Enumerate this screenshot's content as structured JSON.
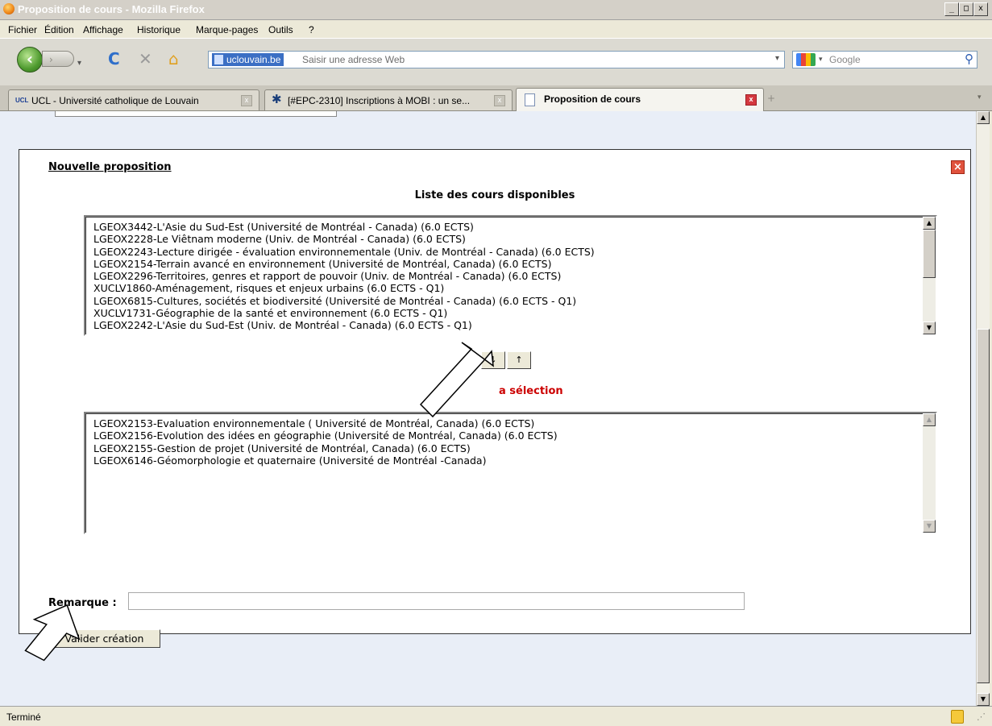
{
  "window": {
    "title": "Proposition de cours - Mozilla Firefox",
    "controls": {
      "minimize": "_",
      "maximize": "□",
      "close": "x"
    }
  },
  "menu": [
    "Fichier",
    "Édition",
    "Affichage",
    "Historique",
    "Marque-pages",
    "Outils",
    "?"
  ],
  "nav": {
    "site_badge": "uclouvain.be",
    "url_placeholder": "Saisir une adresse Web",
    "search_placeholder": "Google"
  },
  "tabs": [
    {
      "label": "UCL - Université catholique de Louvain",
      "favicon": "ucl"
    },
    {
      "label": "[#EPC-2310] Inscriptions à MOBI : un se...",
      "favicon": "jira"
    },
    {
      "label": "Proposition de cours",
      "active": true
    }
  ],
  "panel": {
    "title": "Nouvelle proposition",
    "available_heading": "Liste des cours disponibles",
    "available": [
      "LGEOX3442-L'Asie du Sud-Est (Université de Montréal - Canada) (6.0 ECTS)",
      "LGEOX2228-Le Viêtnam moderne (Univ. de Montréal - Canada) (6.0 ECTS)",
      "LGEOX2243-Lecture dirigée - évaluation environnementale (Univ. de Montréal - Canada) (6.0 ECTS)",
      "LGEOX2154-Terrain avancé en environnement (Université de Montréal, Canada) (6.0 ECTS)",
      "LGEOX2296-Territoires, genres et rapport de pouvoir (Univ. de Montréal - Canada) (6.0 ECTS)",
      "XUCLV1860-Aménagement, risques et enjeux urbains (6.0 ECTS - Q1)",
      "LGEOX6815-Cultures, sociétés et biodiversité (Université de Montréal - Canada) (6.0 ECTS - Q1)",
      "XUCLV1731-Géographie de la santé et environnement (6.0 ECTS - Q1)",
      "LGEOX2242-L'Asie du Sud-Est (Univ. de Montréal - Canada) (6.0 ECTS - Q1)"
    ],
    "move_down_label": "↓",
    "move_up_label": "↑",
    "selection_heading": "a sélection",
    "selection": [
      "LGEOX2153-Evaluation environnementale ( Université de Montréal, Canada) (6.0 ECTS)",
      "LGEOX2156-Evolution des idées en géographie (Université de Montréal, Canada) (6.0 ECTS)",
      "LGEOX2155-Gestion de projet (Université de Montréal, Canada) (6.0 ECTS)",
      "LGEOX6146-Géomorphologie et quaternaire (Université de Montréal -Canada)"
    ],
    "remark_label": "Remarque :",
    "remark_value": "",
    "submit_label": "Valider création"
  },
  "status": {
    "text": "Terminé"
  },
  "colors": {
    "selection_heading": "#cc0000",
    "tab_close_active": "#d4383f",
    "panel_close": "#e0523d"
  }
}
